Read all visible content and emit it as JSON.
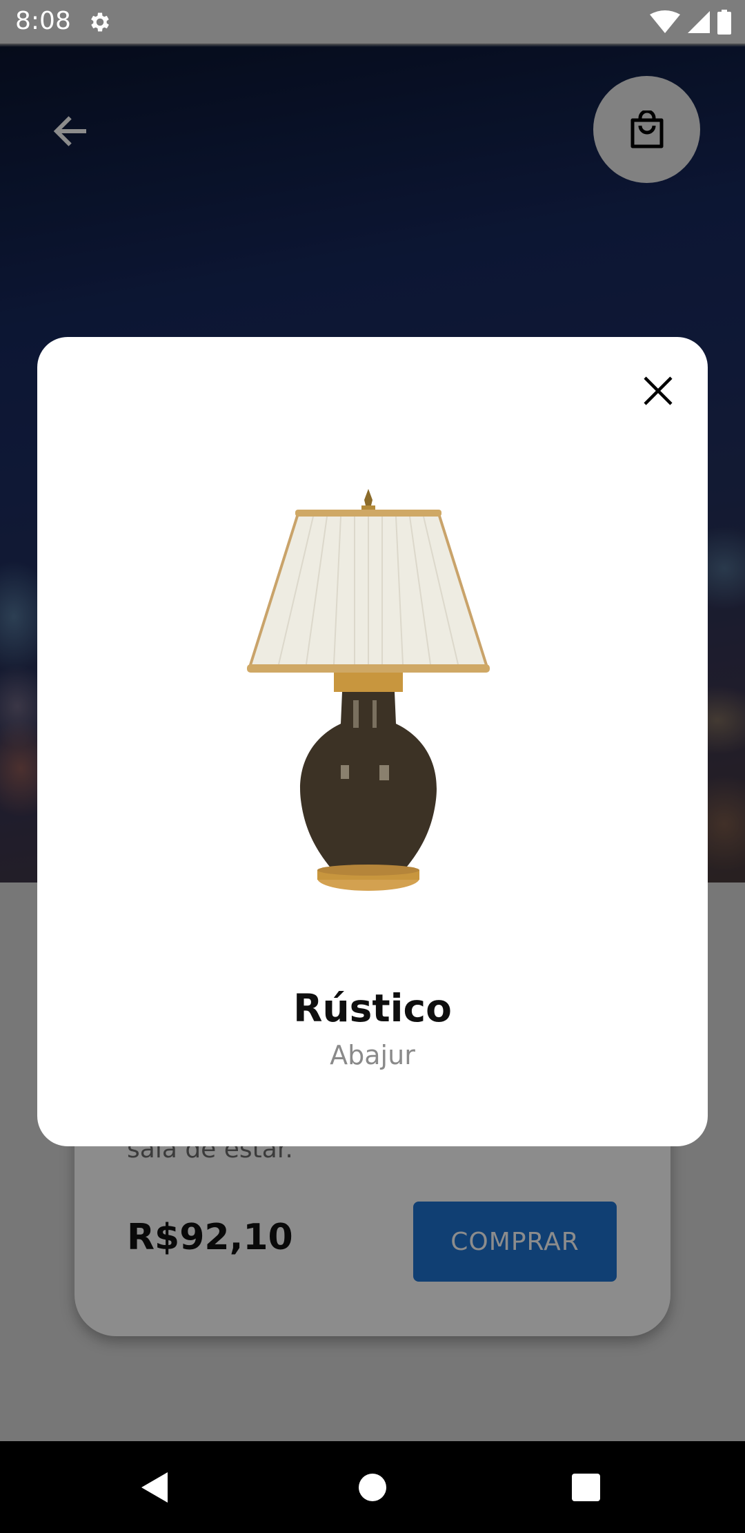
{
  "status_bar": {
    "time": "8:08",
    "icons": [
      "settings-gear-icon",
      "wifi-icon",
      "cellular-signal-icon",
      "battery-icon"
    ]
  },
  "header": {
    "back_icon": "arrow-back-icon",
    "cart_icon": "shopping-bag-icon"
  },
  "product_card": {
    "description_fragment": "sala de estar.",
    "price": "R$92,10",
    "buy_label": "COMPRAR"
  },
  "dialog": {
    "close_icon": "close-icon",
    "image": "table-lamp-image",
    "title": "Rústico",
    "category": "Abajur"
  },
  "nav_bar": {
    "icons": [
      "nav-back-icon",
      "nav-home-icon",
      "nav-recents-icon"
    ]
  },
  "colors": {
    "accent_button": "#1e73d2",
    "hero_dark": "#0a1530",
    "hero_mid": "#1c2c62",
    "status_bar": "#7d7d7d",
    "nav_bar": "#000000"
  }
}
